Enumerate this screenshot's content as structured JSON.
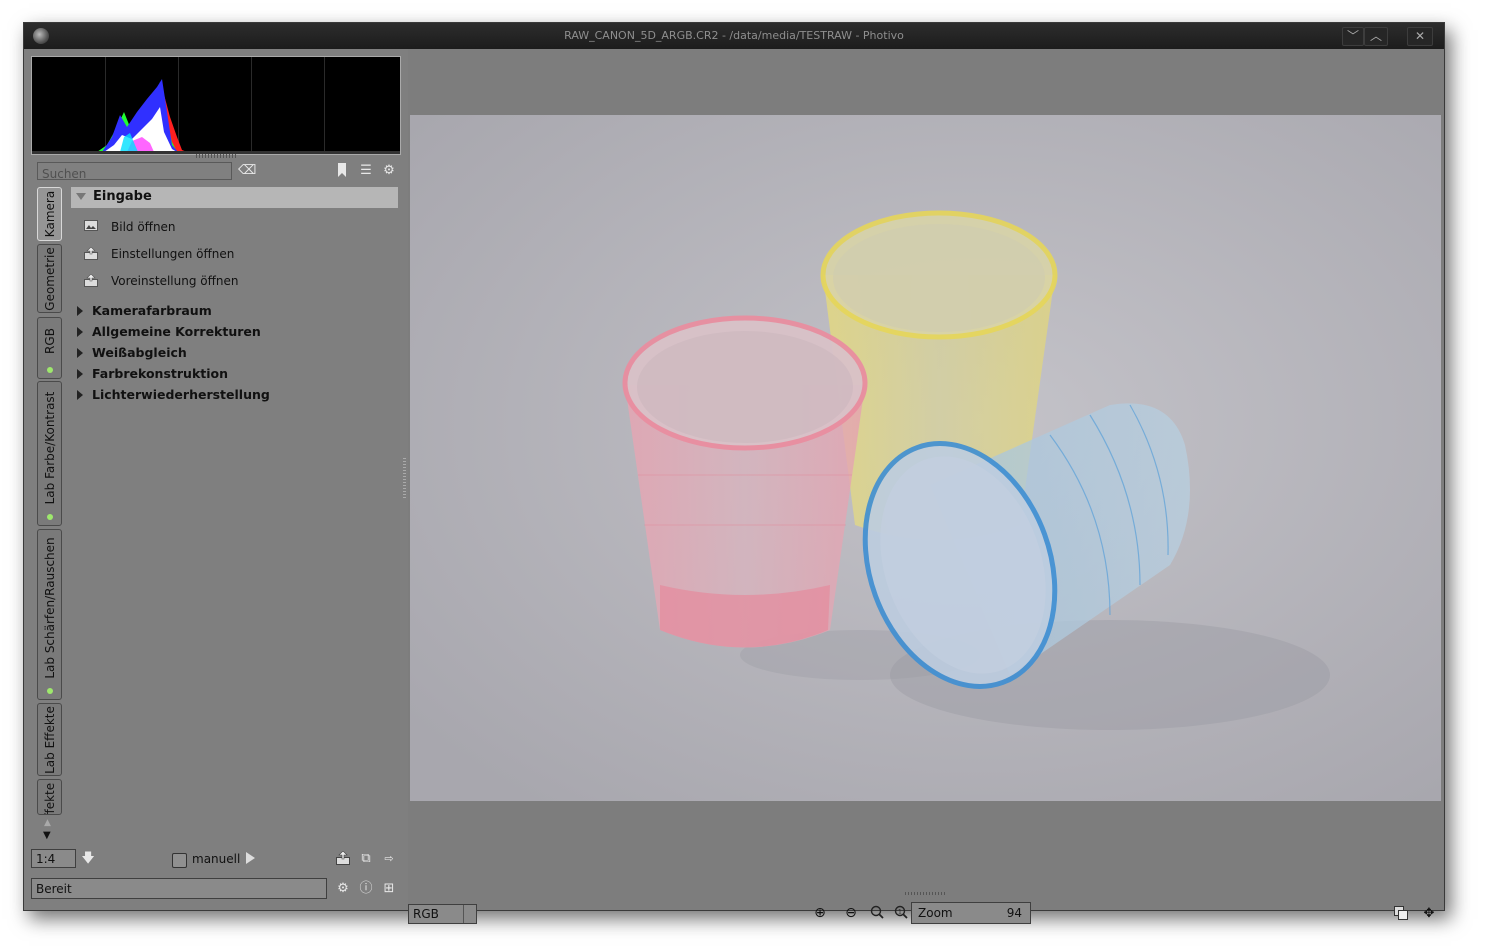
{
  "window": {
    "title": "RAW_CANON_5D_ARGB.CR2 - /data/media/TESTRAW - Photivo",
    "buttons": [
      "﹀",
      "︿",
      "✕"
    ]
  },
  "search": {
    "placeholder": "Suchen"
  },
  "tabs": [
    {
      "label": "Kamera",
      "active": true,
      "indicator": false
    },
    {
      "label": "Geometrie",
      "active": false,
      "indicator": false
    },
    {
      "label": "RGB",
      "active": false,
      "indicator": true
    },
    {
      "label": "Lab Farbe/Kontrast",
      "active": false,
      "indicator": true
    },
    {
      "label": "Lab Schärfen/Rauschen",
      "active": false,
      "indicator": true
    },
    {
      "label": "Lab Effekte",
      "active": false,
      "indicator": false
    },
    {
      "label": "Effekte",
      "active": false,
      "indicator": false
    }
  ],
  "section": {
    "title": "Eingabe",
    "items": [
      {
        "label": "Bild öffnen",
        "icon": "image-open-icon"
      },
      {
        "label": "Einstellungen öffnen",
        "icon": "folder-open-icon"
      },
      {
        "label": "Voreinstellung öffnen",
        "icon": "folder-open-icon"
      }
    ]
  },
  "groups": [
    "Kamerafarbraum",
    "Allgemeine Korrekturen",
    "Weißabgleich",
    "Farbrekonstruktion",
    "Lichterwiederherstellung"
  ],
  "bottom": {
    "scale": "1:4",
    "manual_label": "manuell",
    "status": "Bereit",
    "colorspace": "RGB",
    "zoom_label": "Zoom",
    "zoom_value": "94"
  },
  "colors": {
    "accent_dot": "#9ee86d",
    "panel": "#7f7f7f",
    "titlebar": "#222222"
  }
}
